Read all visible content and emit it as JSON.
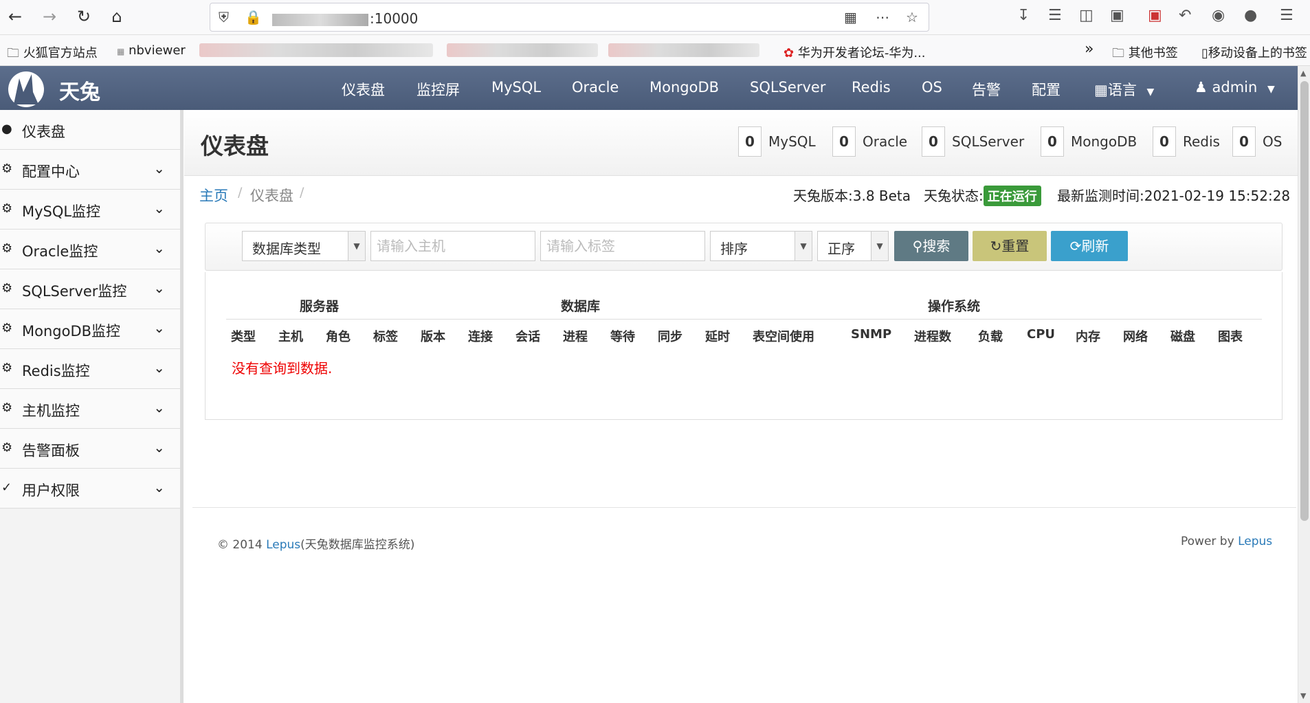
{
  "browser": {
    "url_suffix": ":10000",
    "bookmarks": [
      {
        "label": "火狐官方站点"
      },
      {
        "label": "nbviewer"
      },
      {
        "label": "华为开发者论坛-华为..."
      },
      {
        "label": "其他书签"
      },
      {
        "label": "移动设备上的书签"
      }
    ]
  },
  "navbar": {
    "brand": "天兔",
    "items": [
      "仪表盘",
      "监控屏",
      "MySQL",
      "Oracle",
      "MongoDB",
      "SQLServer",
      "Redis",
      "OS",
      "告警",
      "配置"
    ],
    "language": "语言",
    "user": "admin"
  },
  "sidebar": {
    "items": [
      {
        "label": "仪表盘",
        "icon": "comment-icon",
        "expandable": false
      },
      {
        "label": "配置中心",
        "icon": "dashboard-icon",
        "expandable": true
      },
      {
        "label": "MySQL监控",
        "icon": "dashboard-icon",
        "expandable": true
      },
      {
        "label": "Oracle监控",
        "icon": "dashboard-icon",
        "expandable": true
      },
      {
        "label": "SQLServer监控",
        "icon": "dashboard-icon",
        "expandable": true
      },
      {
        "label": "MongoDB监控",
        "icon": "dashboard-icon",
        "expandable": true
      },
      {
        "label": "Redis监控",
        "icon": "dashboard-icon",
        "expandable": true
      },
      {
        "label": "主机监控",
        "icon": "dashboard-icon",
        "expandable": true
      },
      {
        "label": "告警面板",
        "icon": "dashboard-icon",
        "expandable": true
      },
      {
        "label": "用户权限",
        "icon": "wrench-icon",
        "expandable": true
      }
    ]
  },
  "header": {
    "title": "仪表盘",
    "stats": [
      {
        "count": "0",
        "name": "MySQL"
      },
      {
        "count": "0",
        "name": "Oracle"
      },
      {
        "count": "0",
        "name": "SQLServer"
      },
      {
        "count": "0",
        "name": "MongoDB"
      },
      {
        "count": "0",
        "name": "Redis"
      },
      {
        "count": "0",
        "name": "OS"
      }
    ]
  },
  "breadcrumb": {
    "home": "主页",
    "current": "仪表盘",
    "separator": "/",
    "version_label": "天兔版本:3.8 Beta",
    "status_label": "天兔状态:",
    "status_badge": "正在运行",
    "last_check": "最新监测时间:2021-02-19 15:52:28"
  },
  "filters": {
    "db_type": "数据库类型",
    "host_placeholder": "请输入主机",
    "tag_placeholder": "请输入标签",
    "sort": "排序",
    "order": "正序",
    "search_btn": "搜索",
    "reset_btn": "重置",
    "refresh_btn": "刷新"
  },
  "table": {
    "groups": [
      "服务器",
      "数据库",
      "操作系统"
    ],
    "columns": [
      "类型",
      "主机",
      "角色",
      "标签",
      "版本",
      "连接",
      "会话",
      "进程",
      "等待",
      "同步",
      "延时",
      "表空间使用",
      "SNMP",
      "进程数",
      "负载",
      "CPU",
      "内存",
      "网络",
      "磁盘",
      "图表"
    ],
    "empty_message": "没有查询到数据."
  },
  "footer": {
    "copyright_prefix": "© 2014 ",
    "copyright_link": "Lepus",
    "copyright_suffix": "(天兔数据库监控系统)",
    "power_prefix": "Power by ",
    "power_link": "Lepus"
  },
  "colors": {
    "navbar": "#4a5b78",
    "link": "#2a7ab8",
    "search_btn": "#5f7a84",
    "reset_btn": "#c9c57a",
    "refresh_btn": "#3aa0cc",
    "status_badge": "#3a9a3a",
    "empty_text": "#ee0000"
  }
}
